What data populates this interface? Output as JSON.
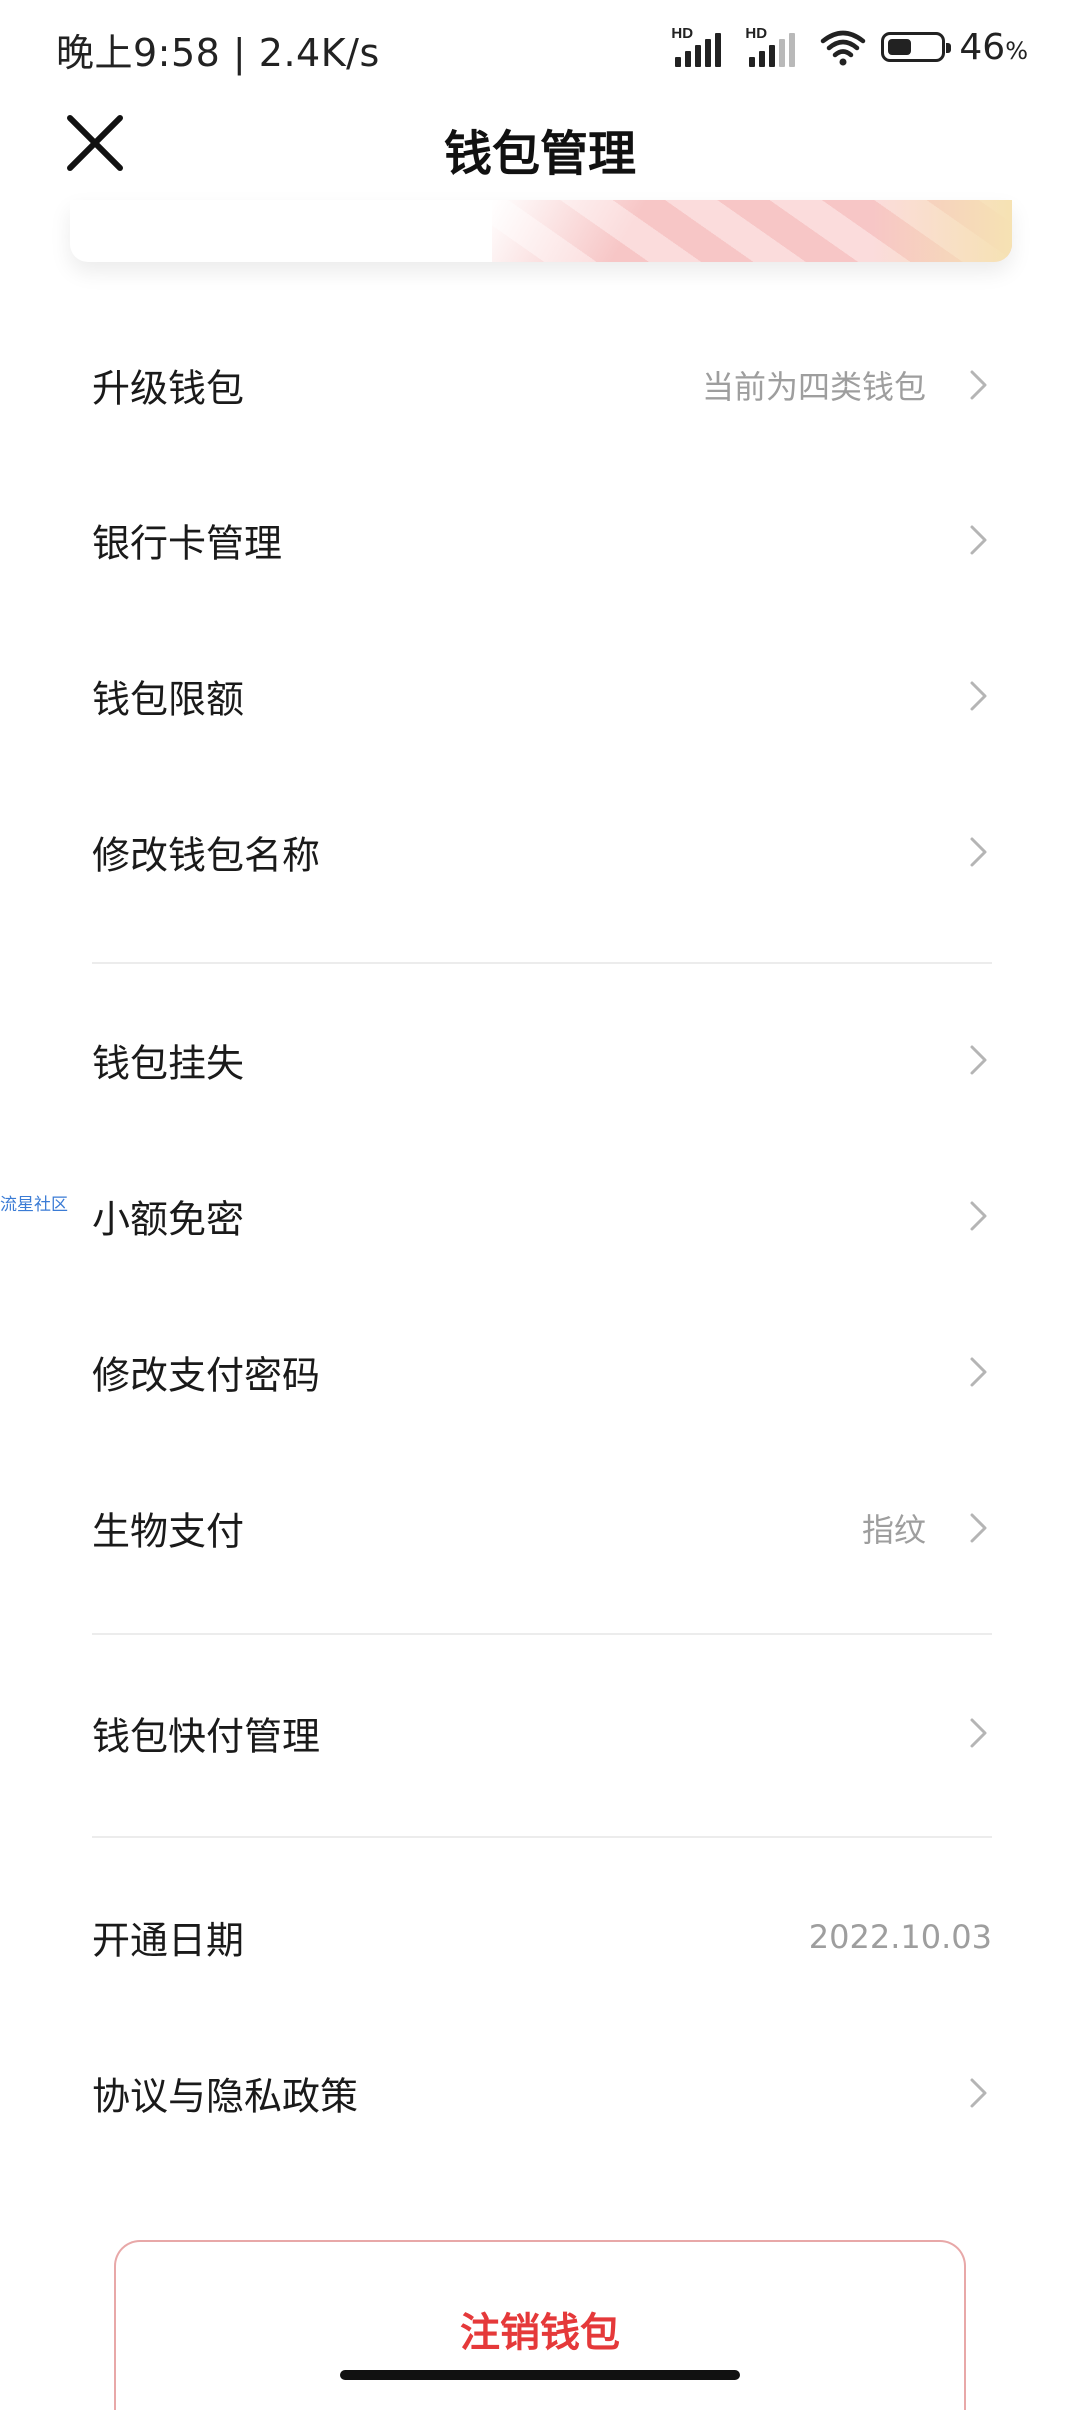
{
  "status_bar": {
    "time_speed": "晚上9:58 | 2.4K/s",
    "network_badge": "HD",
    "battery_level": 46,
    "battery_text": "46",
    "battery_unit": "%"
  },
  "header": {
    "title": "钱包管理",
    "close_icon": "close-icon"
  },
  "menu": {
    "upgrade": {
      "label": "升级钱包",
      "value": "当前为四类钱包"
    },
    "bank_card": {
      "label": "银行卡管理"
    },
    "limit": {
      "label": "钱包限额"
    },
    "rename": {
      "label": "修改钱包名称"
    },
    "report_loss": {
      "label": "钱包挂失"
    },
    "small_free": {
      "label": "小额免密"
    },
    "change_pwd": {
      "label": "修改支付密码"
    },
    "biometric": {
      "label": "生物支付",
      "value": "指纹"
    },
    "quick_pay": {
      "label": "钱包快付管理"
    },
    "open_date": {
      "label": "开通日期",
      "value": "2022.10.03"
    },
    "agreement": {
      "label": "协议与隐私政策"
    }
  },
  "watermark": "流星社区",
  "cancel_button": "注销钱包",
  "colors": {
    "accent_red": "#e5393a",
    "secondary_text": "#9e9e9e",
    "divider": "#ececec"
  }
}
